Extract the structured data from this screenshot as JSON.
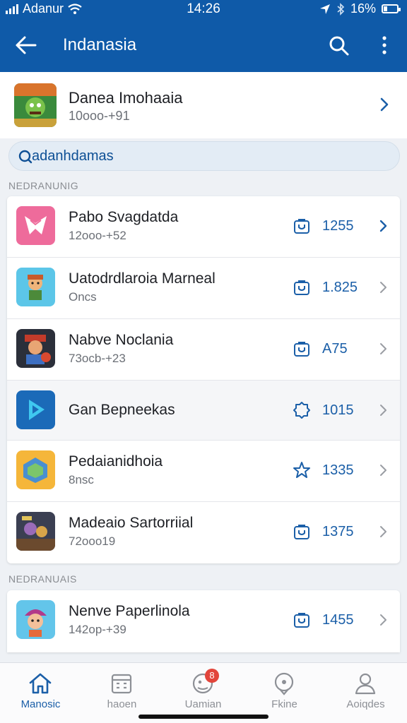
{
  "status": {
    "carrier": "Adanur",
    "time": "14:26",
    "battery": "16%"
  },
  "header": {
    "title": "Indanasia"
  },
  "featured": {
    "name": "Danea Imohaaia",
    "sub": "10ooo-+91"
  },
  "search": {
    "value": "adanhdamas"
  },
  "sections": [
    "NEDRANUNIG",
    "NEDRANUAIS"
  ],
  "items": [
    {
      "name": "Pabo Svagdatda",
      "sub": "12ooo-+52",
      "count": "1255",
      "badge": "bag-icon",
      "palette": "#ee6b9b"
    },
    {
      "name": "Uatodrdlaroia Marneal",
      "sub": "Oncs",
      "count": "1.825",
      "badge": "bag-icon",
      "palette": "#5cc6e8"
    },
    {
      "name": "Nabve Noclania",
      "sub": "73ocb-+23",
      "count": "A75",
      "badge": "bag-icon",
      "palette": "#2b2f3a"
    },
    {
      "name": "Gan Bepneekas",
      "sub": "",
      "count": "1015",
      "badge": "badge-icon",
      "palette": "#1b6ab8"
    },
    {
      "name": "Pedaianidhoia",
      "sub": "8nsc",
      "count": "1335",
      "badge": "star-icon",
      "palette": "#f5b63a"
    },
    {
      "name": "Madeaio Sartorriial",
      "sub": "72ooo19",
      "count": "1375",
      "badge": "bag-icon",
      "palette": "#3b3f52"
    }
  ],
  "items2": [
    {
      "name": "Nenve Paperlinola",
      "sub": "142op-+39",
      "count": "1455",
      "badge": "bag-icon",
      "palette": "#63c5ea"
    }
  ],
  "nav": [
    {
      "label": "Manosic",
      "icon": "home-icon"
    },
    {
      "label": "haoen",
      "icon": "calendar-icon"
    },
    {
      "label": "Uamian",
      "icon": "chat-icon",
      "badge": "8"
    },
    {
      "label": "Fkine",
      "icon": "location-icon"
    },
    {
      "label": "Aoiqdes",
      "icon": "person-icon"
    }
  ],
  "colors": {
    "primary": "#0f5aa8",
    "accent": "#1b5fa8",
    "badge": "#e2453b"
  }
}
